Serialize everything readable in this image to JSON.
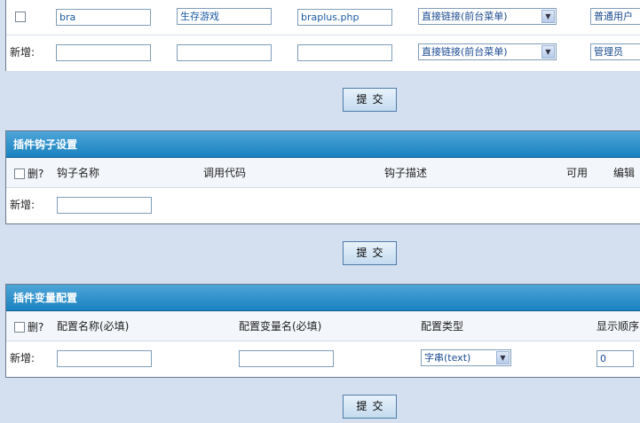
{
  "top_table": {
    "row1": {
      "name": "bra",
      "title": "生存游戏",
      "file": "braplus.php",
      "link_type": "直接链接(前台菜单)",
      "permission": "普通用户"
    },
    "new_row": {
      "label": "新增:",
      "link_type": "直接链接(前台菜单)",
      "permission": "管理员"
    },
    "submit": "提交"
  },
  "hooks": {
    "title": "插件钩子设置",
    "columns": [
      "删?",
      "钩子名称",
      "调用代码",
      "钩子描述",
      "可用",
      "编辑"
    ],
    "new_label": "新增:",
    "submit": "提交"
  },
  "vars": {
    "title": "插件变量配置",
    "columns": [
      "删?",
      "配置名称(必填)",
      "配置变量名(必填)",
      "配置类型",
      "显示顺序"
    ],
    "new_label": "新增:",
    "type_value": "字串(text)",
    "order_value": "0",
    "submit": "提交"
  }
}
